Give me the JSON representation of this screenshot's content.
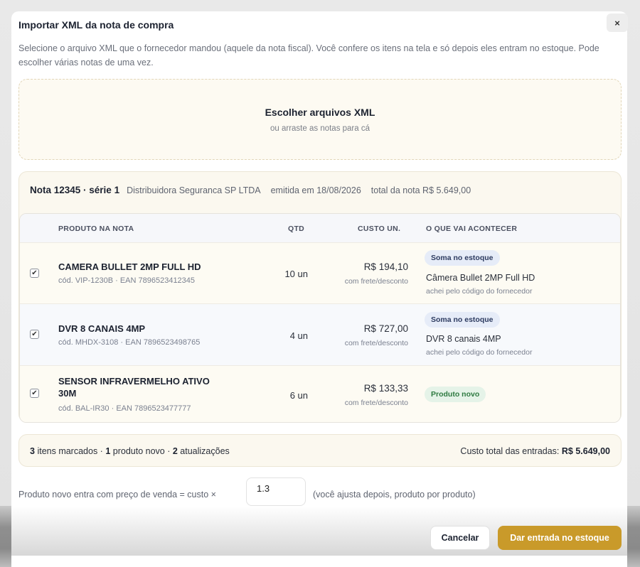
{
  "dialog": {
    "title": "Importar XML da nota de compra",
    "close_label": "×",
    "description": "Selecione o arquivo XML que o fornecedor mandou (aquele da nota fiscal). Você confere os itens na tela e só depois eles entram no estoque. Pode escolher várias notas de uma vez."
  },
  "dropzone": {
    "title": "Escolher arquivos XML",
    "subtitle": "ou arraste as notas para cá"
  },
  "nota": {
    "number": "Nota 12345 · série 1",
    "supplier": "Distribuidora Seguranca SP LTDA",
    "issued": "emitida em 18/08/2026",
    "total": "total da nota R$ 5.649,00",
    "columns": {
      "produto": "PRODUTO NA NOTA",
      "qtd": "QTD",
      "custo": "CUSTO UN.",
      "acao": "O QUE VAI ACONTECER"
    },
    "items": [
      {
        "checked": true,
        "name": "CAMERA BULLET 2MP FULL HD",
        "code": "cód. VIP-1230B · EAN 7896523412345",
        "qty": "10 un",
        "cost": "R$ 194,10",
        "cost_note": "com frete/desconto",
        "badge": "Soma no estoque",
        "match": "Câmera Bullet 2MP Full HD",
        "match_note": "achei pelo código do fornecedor"
      },
      {
        "checked": true,
        "name": "DVR 8 CANAIS 4MP",
        "code": "cód. MHDX-3108 · EAN 7896523498765",
        "qty": "4 un",
        "cost": "R$ 727,00",
        "cost_note": "com frete/desconto",
        "badge": "Soma no estoque",
        "match": "DVR 8 canais 4MP",
        "match_note": "achei pelo código do fornecedor"
      },
      {
        "checked": true,
        "name_line1": "SENSOR INFRAVERMELHO ATIVO",
        "name_line2": "30M",
        "code": "cód. BAL-IR30 · EAN 7896523477777",
        "qty": "6 un",
        "cost": "R$ 133,33",
        "cost_note": "com frete/desconto",
        "badge": "Produto novo"
      }
    ]
  },
  "summary": {
    "marked_count": "3",
    "marked_label": "itens marcados ·",
    "new_count": "1",
    "new_label": "produto novo ·",
    "update_count": "2",
    "update_label": "atualizações",
    "total_label": "Custo total das entradas:",
    "total_value": "R$ 5.649,00"
  },
  "markup": {
    "label": "Produto novo entra com preço de venda = custo ×",
    "value": "1.3",
    "hint": "(você ajusta depois, produto por produto)"
  },
  "footer": {
    "cancel": "Cancelar",
    "confirm": "Dar entrada no estoque"
  },
  "colors": {
    "accent": "#c99a2a",
    "badge_blue_bg": "#e6ecf8",
    "badge_green_bg": "#e5f3e8"
  }
}
